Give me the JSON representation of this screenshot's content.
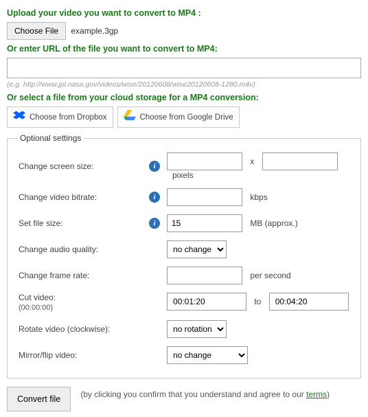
{
  "upload": {
    "title": "Upload your video you want to convert to MP4 :",
    "button": "Choose File",
    "filename": "example.3gp"
  },
  "url": {
    "title": "Or enter URL of the file you want to convert to MP4:",
    "value": "",
    "hint": "(e.g. http://www.jpl.nasa.gov/videos/wise/20120608/wise20120608-1280.m4v)"
  },
  "cloud": {
    "title": "Or select a file from your cloud storage for a MP4 conversion:",
    "dropbox": "Choose from Dropbox",
    "gdrive": "Choose from Google Drive"
  },
  "optional": {
    "legend": "Optional settings",
    "screen_size": {
      "label": "Change screen size:",
      "w": "",
      "x": "x",
      "h": "",
      "unit": "pixels"
    },
    "bitrate": {
      "label": "Change video bitrate:",
      "value": "",
      "unit": "kbps"
    },
    "filesize": {
      "label": "Set file size:",
      "value": "15",
      "unit": "MB (approx.)"
    },
    "audio_quality": {
      "label": "Change audio quality:",
      "value": "no change"
    },
    "frame_rate": {
      "label": "Change frame rate:",
      "value": "",
      "unit": "per second"
    },
    "cut": {
      "label": "Cut video:",
      "hint": "(00:00:00)",
      "from": "00:01:20",
      "to_sep": "to",
      "to": "00:04:20"
    },
    "rotate": {
      "label": "Rotate video (clockwise):",
      "value": "no rotation"
    },
    "mirror": {
      "label": "Mirror/flip video:",
      "value": "no change"
    }
  },
  "submit": {
    "button": "Convert file",
    "note_prefix": "(by clicking you confirm that you understand and agree to our ",
    "terms": "terms",
    "note_suffix": ")"
  }
}
